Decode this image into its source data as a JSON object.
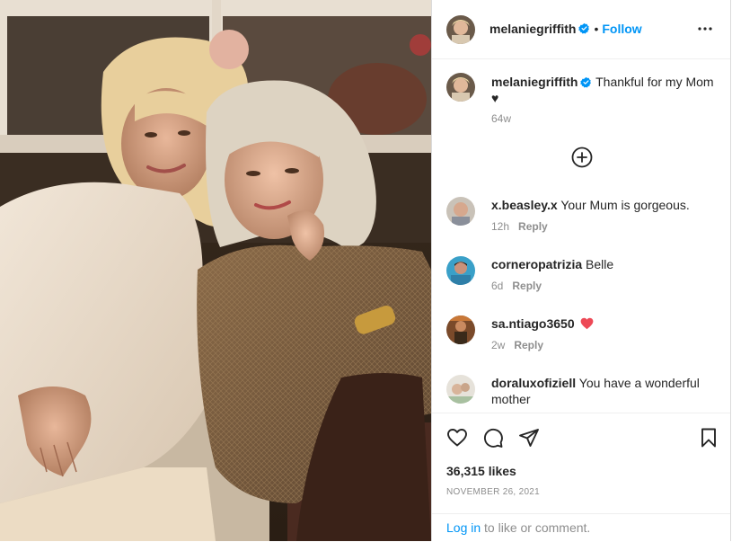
{
  "header": {
    "username": "melaniegriffith",
    "follow_label": "Follow",
    "separator": "•"
  },
  "caption": {
    "username": "melaniegriffith",
    "text": "Thankful for my Mom ♥",
    "time": "64w"
  },
  "comments": [
    {
      "username": "x.beasley.x",
      "text": "Your Mum is gorgeous.",
      "time": "12h",
      "reply_label": "Reply"
    },
    {
      "username": "corneropatrizia",
      "text": "Belle",
      "time": "6d",
      "reply_label": "Reply"
    },
    {
      "username": "sa.ntiago3650",
      "text": "",
      "time": "2w",
      "reply_label": "Reply"
    },
    {
      "username": "doraluxofiziell",
      "text": "You have a wonderful mother",
      "time": "",
      "reply_label": ""
    }
  ],
  "stats": {
    "likes": "36,315 likes",
    "date": "NOVEMBER 26, 2021"
  },
  "login": {
    "link_label": "Log in",
    "rest": "to like or comment."
  },
  "colors": {
    "link_blue": "#0095f6",
    "muted": "#8e8e8e",
    "text": "#262626",
    "heart_red": "#ed4956"
  },
  "icons": [
    "more-icon",
    "verified-icon",
    "add-comment-icon",
    "heart-icon",
    "comment-icon",
    "share-icon",
    "save-icon"
  ]
}
